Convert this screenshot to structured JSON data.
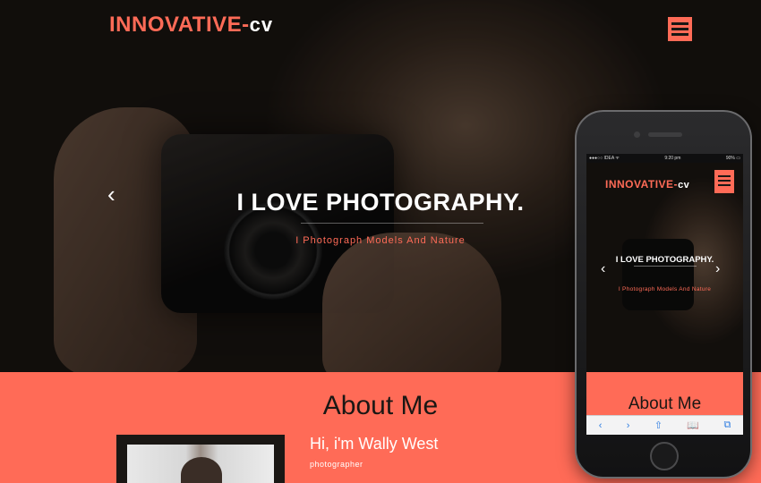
{
  "header": {
    "logo_main": "INNOVATIVE-",
    "logo_suffix": "cv"
  },
  "hero": {
    "title": "I LOVE PHOTOGRAPHY.",
    "subtitle": "I Photograph Models And Nature",
    "prev_arrow": "‹"
  },
  "about": {
    "title": "About Me",
    "greeting": "Hi, i'm Wally West",
    "role": "photographer"
  },
  "phone": {
    "status_left": "●●●○○ IDEA ᯤ",
    "status_time": "9:20 pm",
    "status_right": "90% ▭",
    "logo_main": "INNOVATIVE-",
    "logo_suffix": "cv",
    "title": "I LOVE PHOTOGRAPHY.",
    "subtitle": "I Photograph Models And Nature",
    "prev_arrow": "‹",
    "next_arrow": "›",
    "about_title": "About Me",
    "toolbar": [
      "‹",
      "›",
      "⇧",
      "📖",
      "⧉"
    ]
  },
  "colors": {
    "accent": "#ff6b57",
    "dark": "#1a1714",
    "ios_blue": "#2f7de1"
  }
}
